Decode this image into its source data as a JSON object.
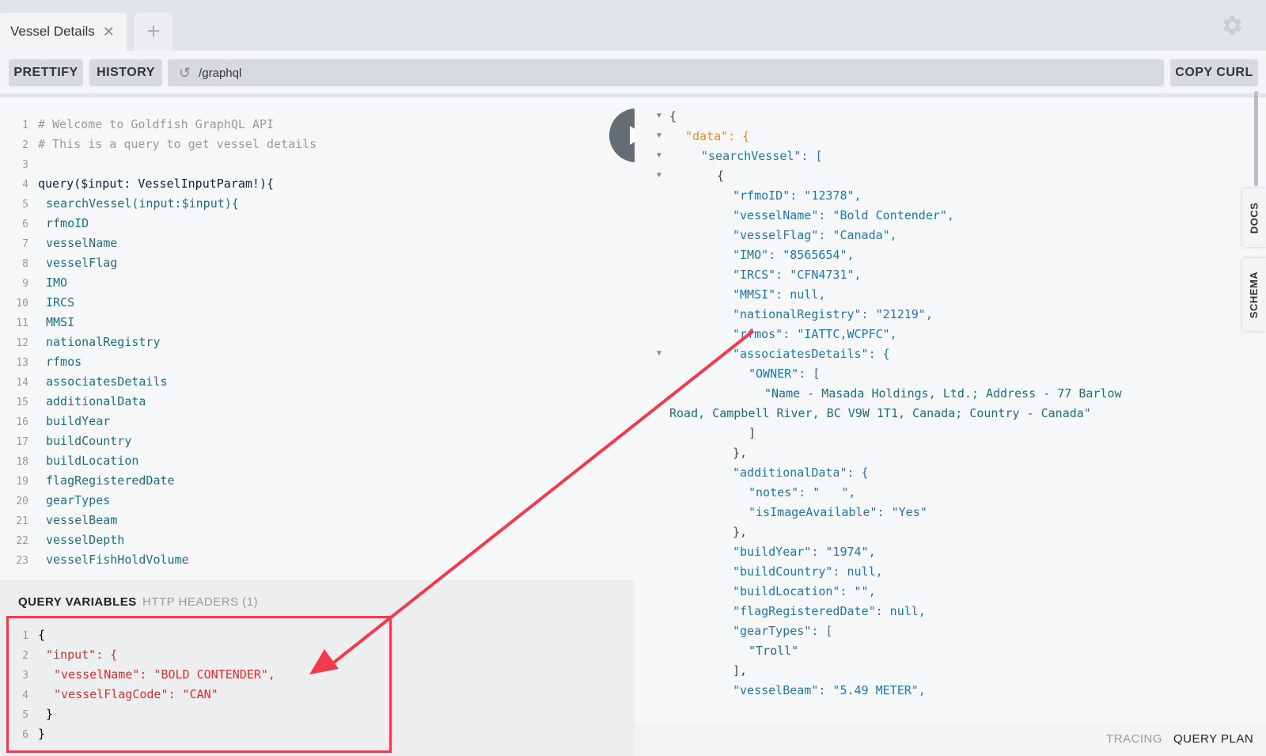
{
  "tabs": {
    "active_title": "Vessel Details",
    "add_label": "+"
  },
  "toolbar": {
    "prettify": "PRETTIFY",
    "history": "HISTORY",
    "url": "/graphql",
    "copy_curl": "COPY CURL"
  },
  "query_lines": [
    {
      "n": "1",
      "t": "# Welcome to Goldfish GraphQL API"
    },
    {
      "n": "2",
      "t": "# This is a query to get vessel details"
    },
    {
      "n": "3",
      "t": ""
    },
    {
      "n": "4",
      "t": "query($input: VesselInputParam!){"
    },
    {
      "n": "5",
      "t": "searchVessel(input:$input){"
    },
    {
      "n": "6",
      "t": "rfmoID"
    },
    {
      "n": "7",
      "t": "vesselName"
    },
    {
      "n": "8",
      "t": "vesselFlag"
    },
    {
      "n": "9",
      "t": "IMO"
    },
    {
      "n": "10",
      "t": "IRCS"
    },
    {
      "n": "11",
      "t": "MMSI"
    },
    {
      "n": "12",
      "t": "nationalRegistry"
    },
    {
      "n": "13",
      "t": "rfmos"
    },
    {
      "n": "14",
      "t": "associatesDetails"
    },
    {
      "n": "15",
      "t": "additionalData"
    },
    {
      "n": "16",
      "t": "buildYear"
    },
    {
      "n": "17",
      "t": "buildCountry"
    },
    {
      "n": "18",
      "t": "buildLocation"
    },
    {
      "n": "19",
      "t": "flagRegisteredDate"
    },
    {
      "n": "20",
      "t": "gearTypes"
    },
    {
      "n": "21",
      "t": "vesselBeam"
    },
    {
      "n": "22",
      "t": "vesselDepth"
    },
    {
      "n": "23",
      "t": "vesselFishHoldVolume"
    }
  ],
  "vars_panel": {
    "tab_query_variables": "QUERY VARIABLES",
    "tab_http_headers": "HTTP HEADERS (1)",
    "lines": [
      {
        "n": "1",
        "t": "{"
      },
      {
        "n": "2",
        "t": "\"input\": {"
      },
      {
        "n": "3",
        "t": "\"vesselName\": \"BOLD CONTENDER\","
      },
      {
        "n": "4",
        "t": "\"vesselFlagCode\": \"CAN\""
      },
      {
        "n": "5",
        "t": "}"
      },
      {
        "n": "6",
        "t": "}"
      }
    ]
  },
  "result_lines": [
    "{",
    "\"data\": {",
    "\"searchVessel\": [",
    "{",
    "\"rfmoID\": \"12378\",",
    "\"vesselName\": \"Bold Contender\",",
    "\"vesselFlag\": \"Canada\",",
    "\"IMO\": \"8565654\",",
    "\"IRCS\": \"CFN4731\",",
    "\"MMSI\": null,",
    "\"nationalRegistry\": \"21219\",",
    "\"rfmos\": \"IATTC,WCPFC\",",
    "\"associatesDetails\": {",
    "\"OWNER\": [",
    "\"Name - Masada Holdings, Ltd.; Address - 77 Barlow",
    "Road, Campbell River, BC V9W 1T1, Canada; Country - Canada\"",
    "]",
    "},",
    "\"additionalData\": {",
    "\"notes\": \"   \",",
    "\"isImageAvailable\": \"Yes\"",
    "},",
    "\"buildYear\": \"1974\",",
    "\"buildCountry\": null,",
    "\"buildLocation\": \"\",",
    "\"flagRegisteredDate\": null,",
    "\"gearTypes\": [",
    "\"Troll\"",
    "],",
    "\"vesselBeam\": \"5.49 METER\","
  ],
  "side_tabs": {
    "docs": "DOCS",
    "schema": "SCHEMA"
  },
  "footer": {
    "tracing": "TRACING",
    "query_plan": "QUERY PLAN"
  },
  "colors": {
    "annotation": "#ef3b4d",
    "run_button": "#646d74"
  }
}
